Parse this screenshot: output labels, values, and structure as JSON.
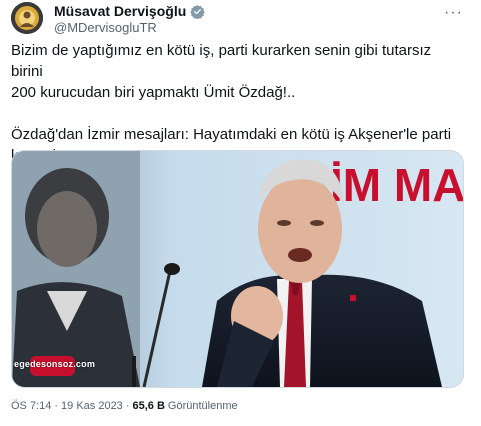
{
  "author": {
    "display_name": "Müsavat Dervişoğlu",
    "handle": "@MDervisogluTR",
    "verified_badge_color": "#829aab"
  },
  "tweet": {
    "line1": "Bizim de yaptığımız en kötü iş, parti kurarken senin gibi tutarsız birini",
    "line2": "200 kurucudan biri yapmaktı Ümit Özdağ!..",
    "line3": "Özdağ'dan İzmir mesajları: Hayatımdaki en kötü iş Akşener'le parti",
    "line4": "kurmaktı"
  },
  "media": {
    "backdrop_text": "İM MA",
    "watermark": "egedesonsoz.com",
    "accent_red": "#c8102e"
  },
  "meta": {
    "time": "ÖS 7:14",
    "separator": "·",
    "date": "19 Kas 2023",
    "views_count": "65,6 B",
    "views_label": "Görüntülenme"
  },
  "icons": {
    "verified": "verified-badge-icon",
    "more": "more-options-icon"
  }
}
